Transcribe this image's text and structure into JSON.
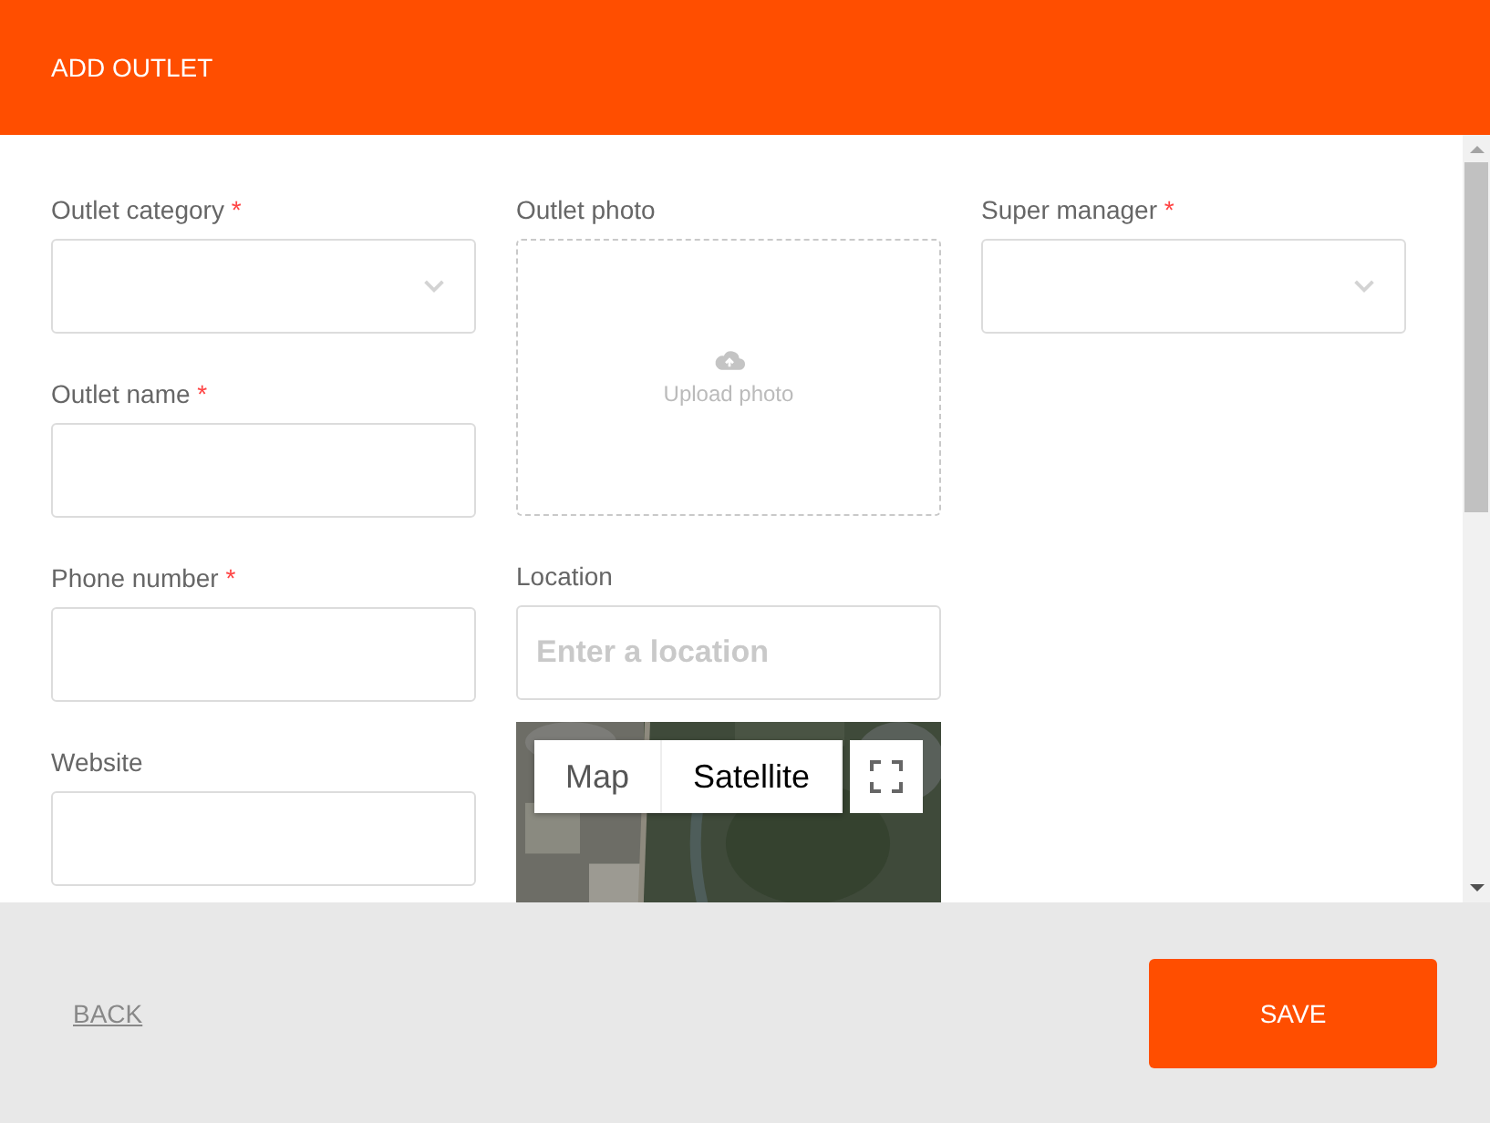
{
  "header": {
    "title": "ADD OUTLET"
  },
  "columns": [
    {
      "fields": [
        {
          "kind": "select",
          "label": "Outlet category",
          "required_mark": "*"
        },
        {
          "kind": "text",
          "label": "Outlet name",
          "required_mark": "*"
        },
        {
          "kind": "text",
          "label": "Phone number",
          "required_mark": "*"
        },
        {
          "kind": "text",
          "label": "Website"
        }
      ]
    },
    {
      "fields": [
        {
          "kind": "upload",
          "label": "Outlet photo",
          "text": "Upload photo"
        },
        {
          "kind": "text",
          "label": "Location",
          "placeholder": "Enter a location"
        },
        {
          "kind": "map",
          "map_types": [
            {
              "label": "Map",
              "selected": false
            },
            {
              "label": "Satellite",
              "selected": true
            }
          ]
        }
      ]
    },
    {
      "fields": [
        {
          "kind": "select",
          "label": "Super manager",
          "required_mark": "*"
        }
      ]
    }
  ],
  "footer": {
    "back": "BACK",
    "save": "SAVE"
  }
}
